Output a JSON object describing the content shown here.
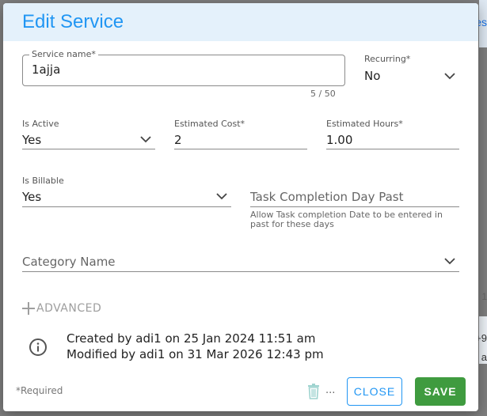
{
  "dialog": {
    "title": "Edit Service",
    "service_name": {
      "label": "Service name*",
      "value": "1ajja",
      "counter": "5 / 50"
    },
    "recurring": {
      "label": "Recurring*",
      "value": "No"
    },
    "is_active": {
      "label": "Is Active",
      "value": "Yes"
    },
    "estimated_cost": {
      "label": "Estimated Cost*",
      "value": "2"
    },
    "estimated_hours": {
      "label": "Estimated Hours*",
      "value": "1.00"
    },
    "is_billable": {
      "label": "Is Billable",
      "value": "Yes"
    },
    "task_completion": {
      "placeholder": "Task Completion Day Past",
      "helper_line1": "Allow Task completion Date to be entered in",
      "helper_line2": "past for these days"
    },
    "category": {
      "placeholder": "Category Name"
    },
    "advanced_label": "ADVANCED",
    "audit": {
      "created": "Created by adi1 on 25 Jan 2024 11:51 am",
      "modified": "Modified by adi1 on 31 Mar 2026 12:43 pm"
    },
    "footer": {
      "required_note": "*Required",
      "ellipsis": "...",
      "close_label": "CLOSE",
      "save_label": "SAVE"
    }
  },
  "background": {
    "snippet_1": "es",
    "snippet_2": "1",
    "snippet_3": "+9",
    "snippet_4": "a"
  },
  "icons": [
    "chevron-down-icon",
    "plus-icon",
    "info-icon",
    "trash-icon"
  ],
  "colors": {
    "accent": "#2196f3",
    "header_bg": "#e4f1fb",
    "save_bg": "#3f9b3f"
  }
}
